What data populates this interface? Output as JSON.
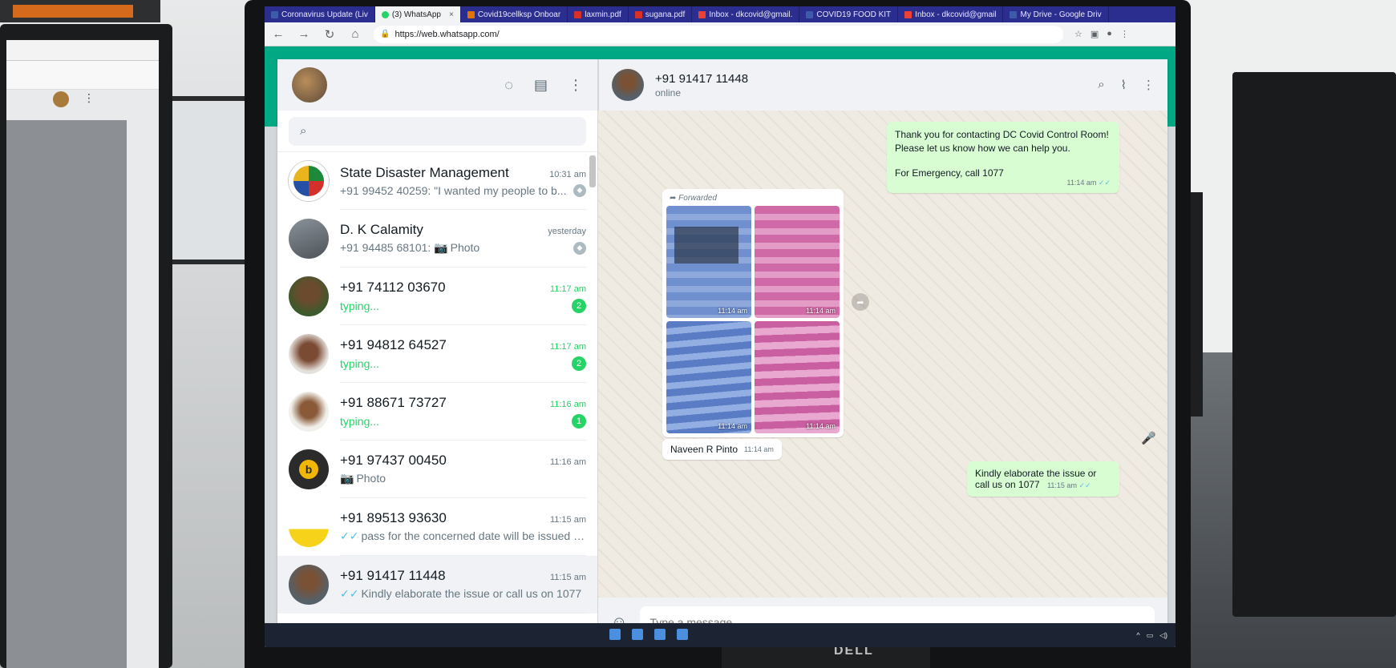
{
  "browser": {
    "tabs": [
      {
        "label": "Coronavirus Update (Liv",
        "active": false,
        "icon": "doc-icon"
      },
      {
        "label": "(3) WhatsApp",
        "active": true,
        "icon": "whatsapp-icon"
      },
      {
        "label": "Covid19cellksp Onboar",
        "active": false,
        "icon": "sheet-icon"
      },
      {
        "label": "laxmin.pdf",
        "active": false,
        "icon": "pdf-icon"
      },
      {
        "label": "sugana.pdf",
        "active": false,
        "icon": "pdf-icon"
      },
      {
        "label": "Inbox - dkcovid@gmail.",
        "active": false,
        "icon": "mail-icon"
      },
      {
        "label": "COVID19 FOOD KIT",
        "active": false,
        "icon": "doc-icon"
      },
      {
        "label": "Inbox - dkcovid@gmail",
        "active": false,
        "icon": "mail-icon"
      },
      {
        "label": "My Drive - Google Driv",
        "active": false,
        "icon": "drive-icon"
      }
    ],
    "url": "https://web.whatsapp.com/",
    "tab_close_glyph": "×"
  },
  "sidebar": {
    "search_placeholder": "",
    "chats": [
      {
        "name": "State Disaster Management",
        "time": "10:31 am",
        "preview": "+91 99452 40259: \"I wanted my people to b...",
        "status": "pinned",
        "avatar": "av1"
      },
      {
        "name": "D. K Calamity",
        "time": "yesterday",
        "preview": "+91 94485 68101:",
        "media": "Photo",
        "status": "pinned",
        "avatar": "av2"
      },
      {
        "name": "+91 74112 03670",
        "time": "11:17 am",
        "preview": "typing...",
        "typing": true,
        "unread": "2",
        "avatar": "av3"
      },
      {
        "name": "+91 94812 64527",
        "time": "11:17 am",
        "preview": "typing...",
        "typing": true,
        "unread": "2",
        "avatar": "av4"
      },
      {
        "name": "+91 88671 73727",
        "time": "11:16 am",
        "preview": "typing...",
        "typing": true,
        "unread": "1",
        "avatar": "av5"
      },
      {
        "name": "+91 97437 00450",
        "time": "11:16 am",
        "preview": "",
        "media": "Photo",
        "avatar": "av6"
      },
      {
        "name": "+91 89513 93630",
        "time": "11:15 am",
        "preview": "pass for the concerned date will be issued o...",
        "ticks": true,
        "avatar": "av7"
      },
      {
        "name": "+91 91417 11448",
        "time": "11:15 am",
        "preview": "Kindly elaborate the issue or call us on 1077",
        "ticks": true,
        "selected": true,
        "avatar": "av8"
      }
    ]
  },
  "conversation": {
    "contact_name": "+91 91417 11448",
    "contact_status": "online",
    "messages": {
      "welcome_line1": "Thank you for contacting DC Covid Control Room! Please let us know how we can help you.",
      "welcome_line2": "For Emergency, call 1077",
      "welcome_time": "11:14 am",
      "forwarded_label": "Forwarded",
      "photo_times": [
        "11:14 am",
        "11:14 am",
        "11:14 am",
        "11:14 am"
      ],
      "sender_name": "Naveen R Pinto",
      "sender_time": "11:14 am",
      "reply_text": "Kindly elaborate the issue or call us on 1077",
      "reply_time": "11:15 am"
    },
    "composer_placeholder": "Type a message"
  },
  "icons": {
    "back": "←",
    "forward": "→",
    "reload": "↻",
    "home": "⌂",
    "lock": "🔒",
    "status": "◌",
    "new_chat": "▤",
    "menu": "⋮",
    "search": "⌕",
    "attach": "⌇",
    "emoji": "☺",
    "mic": "🎤",
    "share": "➦",
    "camera": "📷",
    "ticks": "✓✓",
    "pin": "◆",
    "arrow_fwd": "➦"
  },
  "colors": {
    "accent": "#00a884",
    "unread_badge": "#25d366",
    "outgoing_bubble": "#d9fdd3",
    "read_ticks": "#53bdeb",
    "tabstrip": "#2b2d8f"
  }
}
